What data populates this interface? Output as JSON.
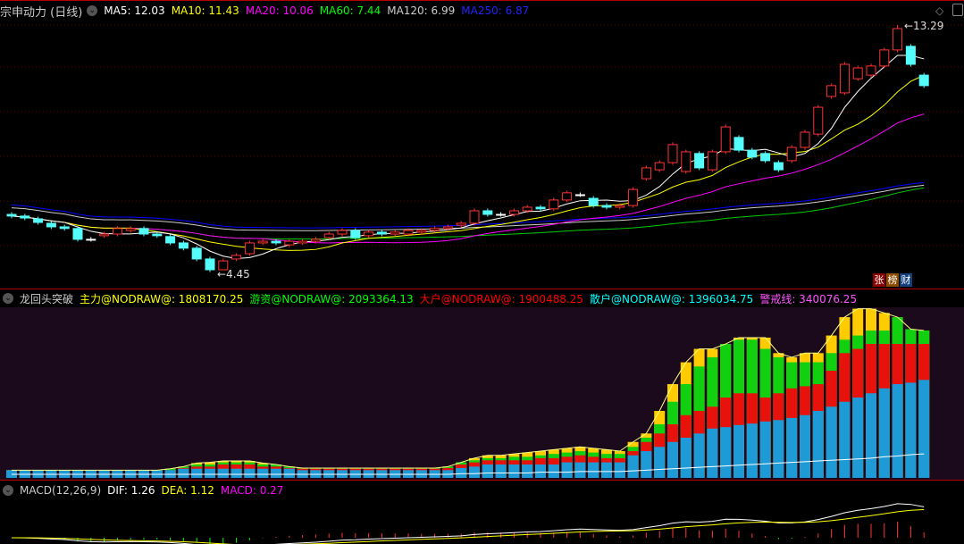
{
  "main": {
    "title": "宗申动力 (日线)",
    "ma": [
      {
        "label": "MA5: 12.03",
        "color": "#ffffff"
      },
      {
        "label": "MA10: 11.43",
        "color": "#ffff00"
      },
      {
        "label": "MA20: 10.06",
        "color": "#ff00ff"
      },
      {
        "label": "MA60: 7.44",
        "color": "#00ff00"
      },
      {
        "label": "MA120: 6.99",
        "color": "#cccccc"
      },
      {
        "label": "MA250: 6.87",
        "color": "#0000ff"
      }
    ],
    "high_label": "13.29",
    "low_label": "4.45",
    "badges": [
      "张",
      "榜",
      "财"
    ]
  },
  "indicator": {
    "title": "龙回头突破",
    "legend": [
      {
        "label": "主力@NODRAW@: 1808170.25",
        "color": "#ffff00"
      },
      {
        "label": "游资@NODRAW@: 2093364.13",
        "color": "#00ff00"
      },
      {
        "label": "大户@NODRAW@: 1900488.25",
        "color": "#ff0000"
      },
      {
        "label": "散户@NODRAW@: 1396034.75",
        "color": "#00ffff"
      },
      {
        "label": "警戒线: 340076.25",
        "color": "#ff55ff"
      }
    ]
  },
  "macd": {
    "title": "MACD(12,26,9)",
    "dif": "DIF: 1.26",
    "dea": "DEA: 1.12",
    "macd": "MACD: 0.27"
  },
  "colors": {
    "up": "#ff3232",
    "down": "#54fcfc",
    "blue": "#1e9bd7",
    "red": "#e8120c",
    "green": "#10d010",
    "yellow": "#ffcc00"
  },
  "chart_data": {
    "type": "candlestick",
    "price_range": [
      4.45,
      13.29
    ],
    "open": [
      6.45,
      6.39,
      6.29,
      6.13,
      6.0,
      5.94,
      5.55,
      5.68,
      5.74,
      5.87,
      5.94,
      5.74,
      5.65,
      5.42,
      5.23,
      4.84,
      4.45,
      4.84,
      5.03,
      5.42,
      5.48,
      5.35,
      5.42,
      5.48,
      5.61,
      5.74,
      5.87,
      5.68,
      5.81,
      5.74,
      5.74,
      5.81,
      5.87,
      5.94,
      6.06,
      6.13,
      6.58,
      6.45,
      6.45,
      6.58,
      6.71,
      6.65,
      6.97,
      7.16,
      7.03,
      6.77,
      6.71,
      6.77,
      7.74,
      8.06,
      8.32,
      8.0,
      8.65,
      8.06,
      8.71,
      9.23,
      8.77,
      8.65,
      8.32,
      8.39,
      8.87,
      9.35,
      10.71,
      10.84,
      11.35,
      11.48,
      11.81,
      12.39,
      12.52,
      11.48
    ],
    "close": [
      6.39,
      6.32,
      6.16,
      6.0,
      5.94,
      5.55,
      5.55,
      5.74,
      5.94,
      5.94,
      5.74,
      5.68,
      5.42,
      5.23,
      4.84,
      4.45,
      4.77,
      4.97,
      5.42,
      5.48,
      5.42,
      5.48,
      5.48,
      5.55,
      5.74,
      5.87,
      5.61,
      5.81,
      5.74,
      5.81,
      5.87,
      5.87,
      5.94,
      6.0,
      6.13,
      6.58,
      6.45,
      6.45,
      6.58,
      6.71,
      6.65,
      6.97,
      7.23,
      7.16,
      6.77,
      6.71,
      6.77,
      7.35,
      8.13,
      8.32,
      8.97,
      8.71,
      8.13,
      8.71,
      9.61,
      8.77,
      8.52,
      8.39,
      8.06,
      8.87,
      9.42,
      10.32,
      11.1,
      11.87,
      11.74,
      11.81,
      12.39,
      13.16,
      11.87,
      11.1
    ],
    "flow_millions": {
      "scattered_blue": [
        0.11,
        0.11,
        0.11,
        0.11,
        0.11,
        0.11,
        0.11,
        0.11,
        0.11,
        0.11,
        0.11,
        0.11,
        0.11,
        0.13,
        0.13,
        0.13,
        0.13,
        0.13,
        0.13,
        0.13,
        0.13,
        0.13,
        0.11,
        0.11,
        0.11,
        0.11,
        0.11,
        0.11,
        0.11,
        0.11,
        0.11,
        0.11,
        0.11,
        0.11,
        0.14,
        0.16,
        0.19,
        0.19,
        0.19,
        0.19,
        0.19,
        0.19,
        0.22,
        0.22,
        0.22,
        0.22,
        0.22,
        0.32,
        0.38,
        0.44,
        0.51,
        0.57,
        0.63,
        0.7,
        0.72,
        0.75,
        0.77,
        0.8,
        0.82,
        0.85,
        0.89,
        0.95,
        1.01,
        1.08,
        1.14,
        1.2,
        1.27,
        1.33,
        1.35,
        1.39
      ],
      "large_red": [
        0.11,
        0.11,
        0.11,
        0.11,
        0.11,
        0.11,
        0.11,
        0.11,
        0.11,
        0.11,
        0.11,
        0.11,
        0.11,
        0.14,
        0.16,
        0.16,
        0.19,
        0.19,
        0.19,
        0.16,
        0.16,
        0.14,
        0.13,
        0.13,
        0.13,
        0.13,
        0.13,
        0.13,
        0.13,
        0.13,
        0.13,
        0.13,
        0.13,
        0.14,
        0.19,
        0.22,
        0.25,
        0.25,
        0.25,
        0.25,
        0.28,
        0.28,
        0.3,
        0.32,
        0.3,
        0.28,
        0.28,
        0.38,
        0.51,
        0.63,
        0.76,
        0.89,
        0.95,
        1.01,
        1.14,
        1.2,
        1.2,
        1.14,
        1.2,
        1.27,
        1.3,
        1.33,
        1.52,
        1.77,
        1.83,
        1.9,
        1.9,
        1.9,
        1.9,
        1.9
      ],
      "hot_money_green": [
        0.11,
        0.11,
        0.11,
        0.11,
        0.11,
        0.11,
        0.11,
        0.11,
        0.11,
        0.11,
        0.11,
        0.11,
        0.13,
        0.16,
        0.19,
        0.19,
        0.22,
        0.22,
        0.22,
        0.19,
        0.19,
        0.16,
        0.14,
        0.14,
        0.14,
        0.14,
        0.14,
        0.14,
        0.14,
        0.14,
        0.14,
        0.14,
        0.14,
        0.16,
        0.22,
        0.25,
        0.28,
        0.28,
        0.3,
        0.3,
        0.32,
        0.34,
        0.36,
        0.38,
        0.36,
        0.34,
        0.34,
        0.44,
        0.57,
        0.76,
        1.08,
        1.33,
        1.58,
        1.71,
        1.9,
        1.96,
        1.96,
        1.83,
        1.71,
        1.64,
        1.64,
        1.64,
        1.77,
        1.96,
        2.02,
        2.09,
        2.09,
        2.28,
        2.11,
        2.09
      ],
      "main_yellow": [
        0.11,
        0.11,
        0.11,
        0.11,
        0.11,
        0.11,
        0.11,
        0.11,
        0.11,
        0.11,
        0.11,
        0.11,
        0.13,
        0.16,
        0.21,
        0.22,
        0.24,
        0.24,
        0.24,
        0.21,
        0.19,
        0.16,
        0.14,
        0.14,
        0.14,
        0.14,
        0.14,
        0.14,
        0.14,
        0.14,
        0.14,
        0.14,
        0.14,
        0.16,
        0.22,
        0.28,
        0.32,
        0.32,
        0.34,
        0.36,
        0.38,
        0.4,
        0.42,
        0.44,
        0.42,
        0.4,
        0.38,
        0.51,
        0.63,
        0.95,
        1.33,
        1.64,
        1.83,
        1.83,
        1.9,
        1.99,
        1.99,
        1.99,
        1.77,
        1.71,
        1.77,
        1.77,
        2.02,
        2.28,
        2.4,
        2.4,
        2.34,
        2.28,
        2.11,
        2.09
      ],
      "alert_line": [
        0.05,
        0.05,
        0.05,
        0.05,
        0.05,
        0.05,
        0.05,
        0.05,
        0.05,
        0.05,
        0.05,
        0.05,
        0.05,
        0.05,
        0.05,
        0.05,
        0.05,
        0.05,
        0.05,
        0.05,
        0.05,
        0.05,
        0.05,
        0.05,
        0.05,
        0.05,
        0.05,
        0.05,
        0.05,
        0.05,
        0.05,
        0.05,
        0.05,
        0.05,
        0.06,
        0.06,
        0.07,
        0.07,
        0.07,
        0.07,
        0.08,
        0.08,
        0.08,
        0.09,
        0.09,
        0.09,
        0.09,
        0.1,
        0.11,
        0.12,
        0.13,
        0.14,
        0.15,
        0.16,
        0.17,
        0.18,
        0.19,
        0.2,
        0.21,
        0.22,
        0.23,
        0.24,
        0.25,
        0.26,
        0.27,
        0.28,
        0.3,
        0.31,
        0.33,
        0.34
      ]
    },
    "flow_range_millions": [
      0,
      2.42
    ]
  }
}
